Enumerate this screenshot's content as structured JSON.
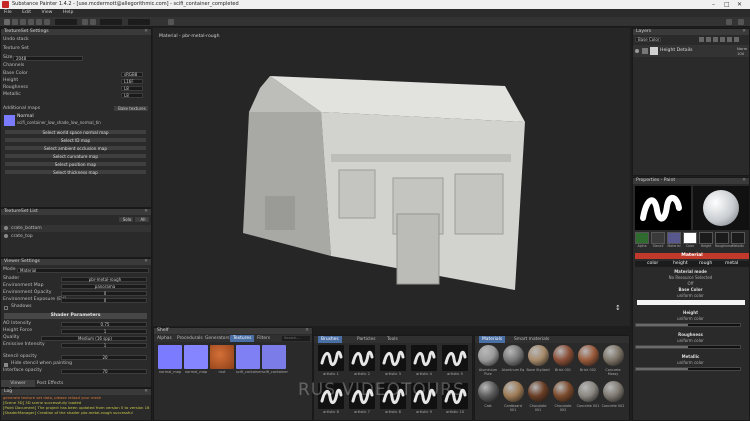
{
  "window": {
    "title": "Substance Painter 1.4.2 - [use.mcdermott@allegorithmic.com] - scifi_container_completed"
  },
  "menu": [
    "File",
    "Edit",
    "View",
    "Help"
  ],
  "texture_set_settings": {
    "header": "TextureSet Settings",
    "name_label": "Undo stack",
    "texture_label": "Texture Set",
    "size_label": "Size",
    "size_value": "2048",
    "channels_label": "Channels",
    "channels": [
      {
        "name": "Base Color",
        "format": "sRGB8"
      },
      {
        "name": "Height",
        "format": "L16F"
      },
      {
        "name": "Roughness",
        "format": "L8"
      },
      {
        "name": "Metallic",
        "format": "L8"
      }
    ],
    "additional_maps_label": "Additional maps",
    "bake_button": "Bake textures",
    "normal_label": "Normal",
    "normal_value": "scifi_container_low_shade_low_normal_tin",
    "map_buttons": [
      "Select world space normal map",
      "Select ID map",
      "Select ambient occlusion map",
      "Select curvature map",
      "Select position map",
      "Select thickness map"
    ]
  },
  "texture_set_list": {
    "header": "TextureSet List",
    "filter_buttons": [
      "Solo",
      "All"
    ],
    "items": [
      "crate_bottom",
      "crate_top"
    ]
  },
  "viewer_settings": {
    "header": "Viewer Settings",
    "mode_label": "Mode",
    "mode_value": "Material",
    "rows": [
      {
        "label": "Shader",
        "value": "pbr-metal-rough"
      },
      {
        "label": "Environment Map",
        "value": "panorama"
      },
      {
        "label": "Environment Opacity",
        "value": "0"
      },
      {
        "label": "Environment Exposure (EV)",
        "value": "0"
      }
    ],
    "shadows_label": "Shadows",
    "shader_params_header": "Shader Parameters",
    "shader_rows": [
      {
        "label": "AO Intensity",
        "value": "0.75"
      },
      {
        "label": "Height Force",
        "value": "1"
      },
      {
        "label": "Quality",
        "value": "Medium (16 spp)"
      },
      {
        "label": "Emissive Intensity",
        "value": "1"
      }
    ],
    "stencil_label": "Stencil opacity",
    "stencil_value": "20",
    "hide_stencil_label": "Hide stencil when painting",
    "ui_opacity_label": "Interface opacity",
    "ui_opacity_value": "70",
    "bottom_tabs": [
      "Viewer Settings",
      "Post Effects"
    ]
  },
  "log": {
    "header": "Log",
    "lines": [
      "generate texture set data, please reload your mesh",
      "[Scene 3D] 3D scene successfully loaded",
      "[Paint Document] The project has been updated from version 0 to version 16",
      "[ShaderManager] Creation of the shader pbr-metal-rough successful"
    ]
  },
  "viewport": {
    "label": "Material - pbr-metal-rough"
  },
  "shelf": {
    "header": "Shelf",
    "tabs": [
      "Alphas",
      "Procedurals",
      "Generators",
      "Textures",
      "Filters"
    ],
    "active_tab": "Textures",
    "search_placeholder": "Search...",
    "textures": [
      {
        "name": "normal_map",
        "color": "#7b7bff"
      },
      {
        "name": "normal_map",
        "color": "#8585ff"
      },
      {
        "name": "rust",
        "color": "#b5582a"
      },
      {
        "name": "scifi_container",
        "color": "#8080f5"
      },
      {
        "name": "scifi_container",
        "color": "#7c7ce8"
      }
    ]
  },
  "brushes": {
    "tabs": [
      "Brushes",
      "Particles",
      "Tools"
    ],
    "active_tab": "Brushes",
    "items": [
      "artistic 1",
      "artistic 2",
      "artistic 3",
      "artistic 4",
      "artistic 5",
      "artistic 6",
      "artistic 7",
      "artistic 8",
      "artistic 9",
      "artistic 10"
    ]
  },
  "materials": {
    "tabs": [
      "Materials",
      "Smart materials"
    ],
    "active_tab": "Materials",
    "items": [
      {
        "name": "Aluminium Pure",
        "color": "#9b9b9b"
      },
      {
        "name": "Aluminum Eq",
        "color": "#7a7a7a"
      },
      {
        "name": "Bone Stylized",
        "color": "#a78a6a"
      },
      {
        "name": "Brick 001",
        "color": "#8a4e36"
      },
      {
        "name": "Brick 002",
        "color": "#9a5a3a"
      },
      {
        "name": "Concrete Mossy",
        "color": "#7d7466"
      },
      {
        "name": "Cast",
        "color": "#5d5d5d"
      },
      {
        "name": "Cardboard 001",
        "color": "#9e7b55"
      },
      {
        "name": "Chocolate 001",
        "color": "#6a3e25"
      },
      {
        "name": "Chocolate 002",
        "color": "#7c4a2b"
      },
      {
        "name": "Concrete 001",
        "color": "#8a8680"
      },
      {
        "name": "Concrete 002",
        "color": "#7f7a72"
      }
    ]
  },
  "layers": {
    "header": "Layers",
    "channel_select": "Base Color",
    "blend_mode": "Norm",
    "opacity": "100",
    "layer_name": "Height Details"
  },
  "properties": {
    "header": "Properties - Paint",
    "slots": [
      {
        "name": "Alpha",
        "color": "#2f6a2f"
      },
      {
        "name": "Stencil",
        "color": "#3a3a3a"
      },
      {
        "name": "Material",
        "color": "#58588f"
      },
      {
        "name": "Color",
        "color": "#ffffff"
      },
      {
        "name": "Height",
        "color": "#1b1b1b"
      },
      {
        "name": "Roughness",
        "color": "#1b1b1b"
      },
      {
        "name": "Metallic",
        "color": "#1b1b1b"
      }
    ],
    "material_header": "Material",
    "channel_toggles": [
      "color",
      "height",
      "rough",
      "metal"
    ],
    "material_mode_label": "Material mode",
    "no_resource_label": "No Resource Selected",
    "material_value": "Off",
    "base_color_label": "Base Color",
    "base_color_sub": "uniform color",
    "height_label": "Height",
    "height_sub": "uniform color",
    "height_level": 0.5,
    "roughness_label": "Roughness",
    "roughness_sub": "uniform color",
    "roughness_level": 0.5,
    "metallic_label": "Metallic",
    "metallic_sub": "uniform color",
    "metallic_level": 0.5
  },
  "watermark": "RUS-VIDEOTOURS",
  "colors": {
    "accent": "#4a6fa5",
    "material_header": "#c0392b",
    "panel_bg": "#2a2a2a",
    "header_bg": "#3a3a3a"
  }
}
